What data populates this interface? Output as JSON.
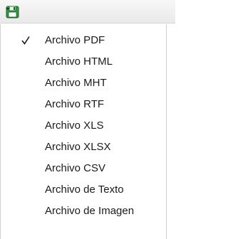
{
  "toolbar": {
    "export_button_icon": "save-export-icon",
    "dropdown_icon": "chevron-down-icon"
  },
  "menu": {
    "items": [
      {
        "label": "Archivo PDF",
        "checked": true
      },
      {
        "label": "Archivo HTML",
        "checked": false
      },
      {
        "label": "Archivo MHT",
        "checked": false
      },
      {
        "label": "Archivo RTF",
        "checked": false
      },
      {
        "label": "Archivo XLS",
        "checked": false
      },
      {
        "label": "Archivo XLSX",
        "checked": false
      },
      {
        "label": "Archivo CSV",
        "checked": false
      },
      {
        "label": "Archivo de Texto",
        "checked": false
      },
      {
        "label": "Archivo de Imagen",
        "checked": false
      }
    ]
  },
  "colors": {
    "icon_green": "#2e9c3a",
    "icon_dark": "#1d5f28",
    "toolbar_bg": "#efefef",
    "text": "#1a1a1a"
  }
}
